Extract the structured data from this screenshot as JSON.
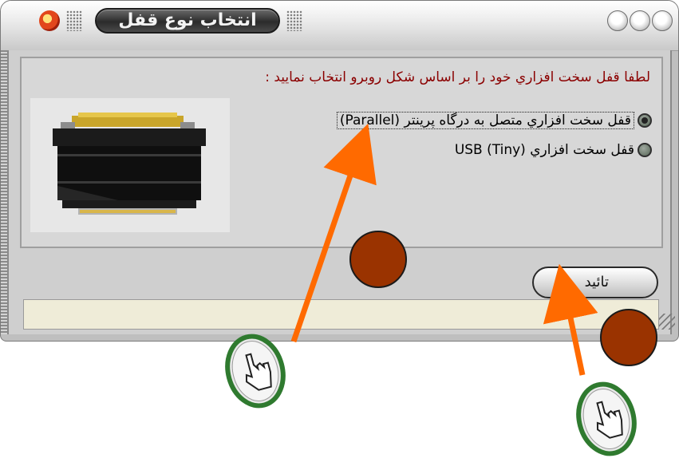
{
  "window": {
    "title": "انتخاب نوع قفل",
    "prompt": "لطفا قفل سخت افزاري خود را بر اساس شكل روبرو انتخاب نماييد :",
    "options": [
      {
        "label": "قفل سخت افزاري متصل به درگاه پرينتر (Parallel)",
        "selected": true
      },
      {
        "label": "قفل سخت افزاري USB    (Tiny)",
        "selected": false
      }
    ],
    "confirm_label": "تائيد",
    "status_text": ""
  },
  "icons": {
    "app": "app-icon",
    "window_controls": [
      "minimize-icon",
      "maximize-icon",
      "close-icon"
    ],
    "connector": "parallel-lock-connector-image",
    "cursor": "hand-cursor-icon"
  },
  "colors": {
    "prompt_text": "#8b0000",
    "marker_circle": "#9a3300",
    "arrow": "#ff6a00"
  }
}
